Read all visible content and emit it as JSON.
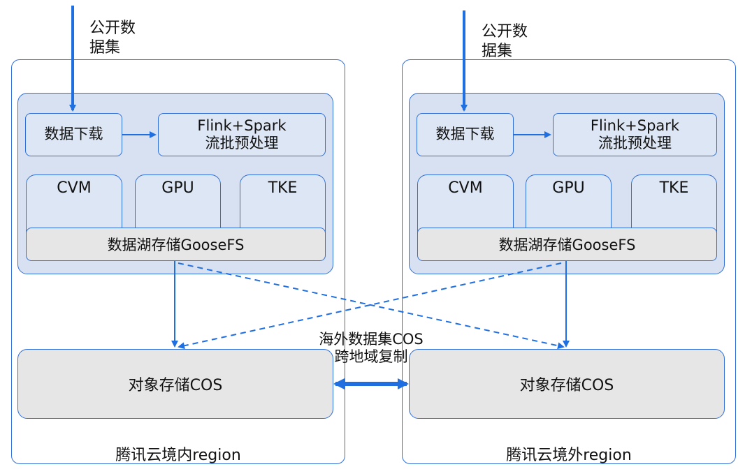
{
  "left_region": {
    "title": "腾讯云境内region",
    "input_label": "公开数\n据集",
    "download": "数据下载",
    "processing": "Flink+Spark\n流批预处理",
    "cvm": "CVM",
    "gpu": "GPU",
    "tke": "TKE",
    "lake": "数据湖存储GooseFS",
    "cos": "对象存储COS"
  },
  "right_region": {
    "title": "腾讯云境外region",
    "input_label": "公开数\n据集",
    "download": "数据下载",
    "processing": "Flink+Spark\n流批预处理",
    "cvm": "CVM",
    "gpu": "GPU",
    "tke": "TKE",
    "lake": "数据湖存储GooseFS",
    "cos": "对象存储COS"
  },
  "replication_label": "海外数据集COS\n跨地域复制",
  "colors": {
    "accent": "#2f6fd6",
    "arrow": "#1f6fe0",
    "inner_fill": "#d7e1f2",
    "gray_fill": "#e6e6e6"
  }
}
